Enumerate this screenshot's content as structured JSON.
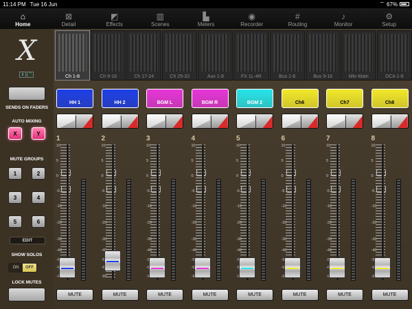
{
  "status_bar": {
    "time": "11:14 PM",
    "date": "Tue 16 Jun",
    "battery": "67%"
  },
  "nav": {
    "tabs": [
      {
        "label": "Home",
        "icon": "home-icon",
        "glyph": "⌂",
        "active": true
      },
      {
        "label": "Detail",
        "icon": "detail-icon",
        "glyph": "⊠",
        "active": false
      },
      {
        "label": "Effects",
        "icon": "effects-icon",
        "glyph": "◩",
        "active": false
      },
      {
        "label": "Scenes",
        "icon": "scenes-icon",
        "glyph": "▥",
        "active": false
      },
      {
        "label": "Meters",
        "icon": "meters-icon",
        "glyph": "▙",
        "active": false
      },
      {
        "label": "Recorder",
        "icon": "recorder-icon",
        "glyph": "◉",
        "active": false
      },
      {
        "label": "Routing",
        "icon": "routing-icon",
        "glyph": "#",
        "active": false
      },
      {
        "label": "Monitor",
        "icon": "monitor-icon",
        "glyph": "♪",
        "active": false
      },
      {
        "label": "Setup",
        "icon": "setup-icon",
        "glyph": "⚙",
        "active": false
      }
    ]
  },
  "left_panel": {
    "logo": "X",
    "info_icon": "i",
    "sends_on_faders": "SENDS ON FADERS",
    "auto_mixing": "AUTO MIXING",
    "auto_mix_x": "X",
    "auto_mix_y": "Y",
    "mute_groups": "MUTE GROUPS",
    "mute_group_buttons": [
      "1",
      "2",
      "3",
      "4",
      "5",
      "6"
    ],
    "edit": "EDIT",
    "show_solos": "SHOW SOLOS",
    "solos_on": "ON",
    "solos_off": "OFF",
    "lock_mutes": "LOCK MUTES"
  },
  "banks": [
    {
      "label": "Ch 1-8",
      "active": true
    },
    {
      "label": "Ch 9-16",
      "active": false
    },
    {
      "label": "Ch 17-24",
      "active": false
    },
    {
      "label": "Ch 25-32",
      "active": false
    },
    {
      "label": "Aux 1-8",
      "active": false
    },
    {
      "label": "FX 1L-4R",
      "active": false
    },
    {
      "label": "Bus 1-8",
      "active": false
    },
    {
      "label": "Bus 9-16",
      "active": false
    },
    {
      "label": "Mtx-Main",
      "active": false
    },
    {
      "label": "DCA 1-8",
      "active": false
    }
  ],
  "scale_labels": [
    "10",
    "5",
    "0",
    "-5",
    "-10",
    "-20",
    "-30",
    "-40",
    "-50",
    "-60",
    "-90"
  ],
  "channels": [
    {
      "number": "1",
      "name": "HH 1",
      "color": "#1e3fe6",
      "text_dark": false,
      "fader": 0.0,
      "mute": "MUTE"
    },
    {
      "number": "2",
      "name": "HH 2",
      "color": "#1e3fe6",
      "text_dark": false,
      "fader": 0.08,
      "mute": "MUTE"
    },
    {
      "number": "3",
      "name": "BGM L",
      "color": "#e636d8",
      "text_dark": false,
      "fader": 0.0,
      "mute": "MUTE"
    },
    {
      "number": "4",
      "name": "BGM R",
      "color": "#e636d8",
      "text_dark": false,
      "fader": 0.0,
      "mute": "MUTE"
    },
    {
      "number": "5",
      "name": "BGM 2",
      "color": "#27e4e8",
      "text_dark": false,
      "fader": 0.0,
      "mute": "MUTE"
    },
    {
      "number": "6",
      "name": "Ch6",
      "color": "#f2e82a",
      "text_dark": true,
      "fader": 0.0,
      "mute": "MUTE"
    },
    {
      "number": "7",
      "name": "Ch7",
      "color": "#f2e82a",
      "text_dark": true,
      "fader": 0.0,
      "mute": "MUTE"
    },
    {
      "number": "8",
      "name": "Ch8",
      "color": "#f2e82a",
      "text_dark": true,
      "fader": 0.0,
      "mute": "MUTE"
    }
  ]
}
